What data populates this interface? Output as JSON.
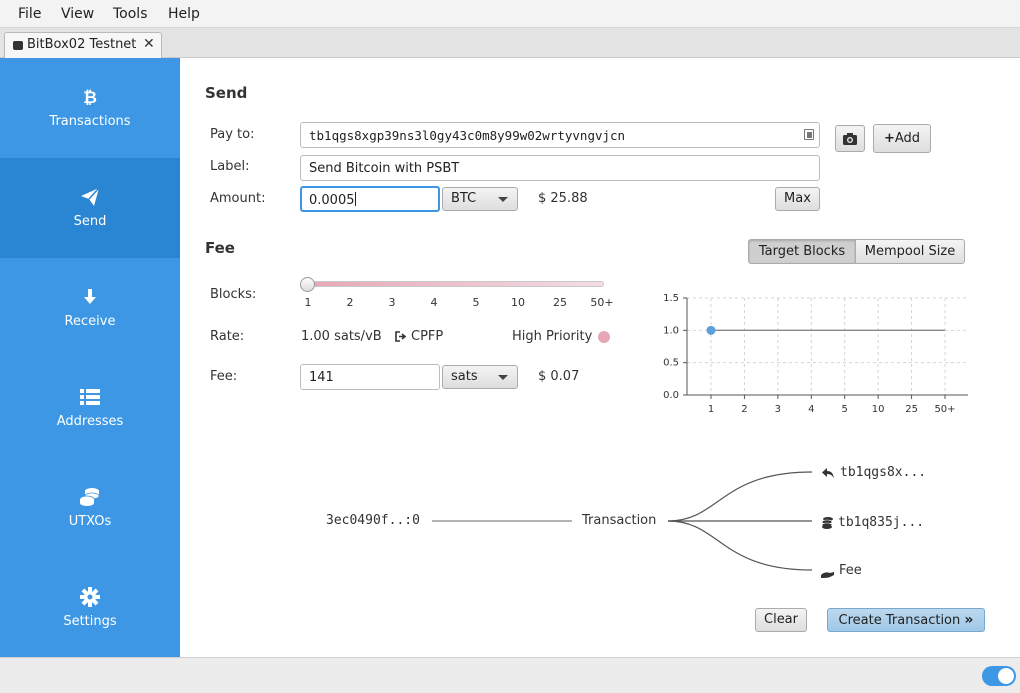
{
  "menu": [
    "File",
    "View",
    "Tools",
    "Help"
  ],
  "tab": {
    "label": "BitBox02 Testnet",
    "close": "✕"
  },
  "sidebar": {
    "items": [
      {
        "label": "Transactions",
        "icon": "bitcoin-icon"
      },
      {
        "label": "Send",
        "icon": "paper-plane-icon",
        "active": true
      },
      {
        "label": "Receive",
        "icon": "arrow-down-icon"
      },
      {
        "label": "Addresses",
        "icon": "list-icon"
      },
      {
        "label": "UTXOs",
        "icon": "coins-icon"
      },
      {
        "label": "Settings",
        "icon": "gear-icon"
      }
    ]
  },
  "send": {
    "title": "Send",
    "pay_to_label": "Pay to:",
    "pay_to_value": "tb1qgs8xgp39ns3l0gy43c0m8y99w02wrtyvngvjcn",
    "label_label": "Label:",
    "label_value": "Send Bitcoin with PSBT",
    "amount_label": "Amount:",
    "amount_value": "0.0005",
    "amount_unit": "BTC",
    "amount_fiat": "$ 25.88",
    "max_button": "Max",
    "add_button": "Add"
  },
  "fee": {
    "title": "Fee",
    "target_blocks": "Target Blocks",
    "mempool_size": "Mempool Size",
    "blocks_label": "Blocks:",
    "block_ticks": [
      "1",
      "2",
      "3",
      "4",
      "5",
      "10",
      "25",
      "50+"
    ],
    "slider_value": 0,
    "rate_label": "Rate:",
    "rate_value": "1.00 sats/vB",
    "cpfp": "CPFP",
    "priority": "High Priority",
    "fee_label": "Fee:",
    "fee_value": "141",
    "fee_unit": "sats",
    "fee_fiat": "$ 0.07"
  },
  "chart_data": {
    "type": "line",
    "categories": [
      "1",
      "2",
      "3",
      "4",
      "5",
      "10",
      "25",
      "50+"
    ],
    "values": [
      1.0,
      1.0,
      1.0,
      1.0,
      1.0,
      1.0,
      1.0,
      1.0
    ],
    "selected_index": 0,
    "y_ticks": [
      "1.5",
      "1.0",
      "0.5",
      "0.0"
    ],
    "ylim": [
      0,
      1.5
    ],
    "grid": true,
    "title": "",
    "xlabel": "",
    "ylabel": ""
  },
  "flow": {
    "input": "3ec0490f..:0",
    "center": "Transaction",
    "outputs": [
      {
        "label": "tb1qgs8x...",
        "icon": "reply-icon"
      },
      {
        "label": "tb1q835j...",
        "icon": "coins-icon"
      },
      {
        "label": "Fee",
        "icon": "hand-icon"
      }
    ]
  },
  "actions": {
    "clear": "Clear",
    "create": "Create Transaction"
  }
}
